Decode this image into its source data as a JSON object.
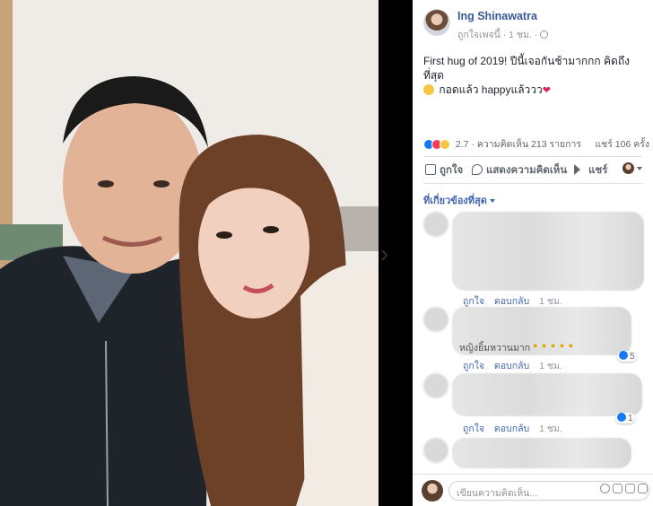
{
  "post": {
    "author": "Ing Shinawatra",
    "meta_liked": "ถูกใจเพจนี้",
    "meta_time": "· 1 ชม. ·",
    "text_line1": "First hug of 2019! ปีนี้เจอกันช้ามากกก คิดถึงที่สุด",
    "text_line2": "กอดแล้ว happyแล้ววว",
    "heart": "❤"
  },
  "stats": {
    "reactions": "2.7",
    "comments": "· ความคิดเห็น 213 รายการ",
    "shares": "แชร์ 106 ครั้ง"
  },
  "actions": {
    "like": "ถูกใจ",
    "comment": "แสดงความคิดเห็น",
    "share": "แชร์"
  },
  "filter": "ที่เกี่ยวข้องที่สุด",
  "comments": [
    {
      "text": "",
      "like_label": "ถูกใจ",
      "reply_label": "ตอบกลับ",
      "time": "1 ชม.",
      "likes": ""
    },
    {
      "text": "หญิงยิ้มหวานมาก",
      "like_label": "ถูกใจ",
      "reply_label": "ตอบกลับ",
      "time": "1 ชม.",
      "likes": "5"
    },
    {
      "text": "",
      "like_label": "ถูกใจ",
      "reply_label": "ตอบกลับ",
      "time": "1 ชม.",
      "likes": "1"
    }
  ],
  "composer": {
    "placeholder": "เขียนความคิดเห็น..."
  },
  "colors": {
    "link": "#365899",
    "accent": "#4267b2",
    "like_blue": "#1877f2"
  }
}
